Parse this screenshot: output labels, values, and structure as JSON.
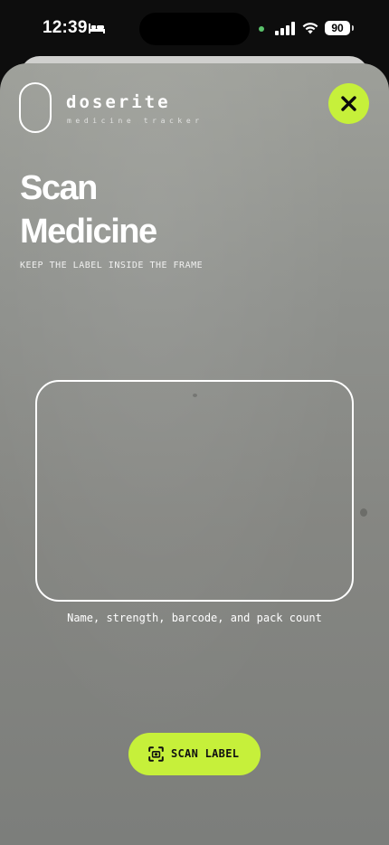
{
  "status_bar": {
    "time": "12:39",
    "battery": "90",
    "icons": [
      "bed-icon",
      "camera-indicator-dot",
      "signal-icon",
      "wifi-icon",
      "battery-icon"
    ]
  },
  "header": {
    "brand_name": "doserite",
    "brand_tagline": "medicine tracker",
    "close_icon": "close-icon"
  },
  "page": {
    "title_line1": "Scan",
    "title_line2": "Medicine",
    "subtitle": "KEEP THE LABEL INSIDE THE FRAME"
  },
  "scanner": {
    "caption": "Name, strength, barcode, and pack count"
  },
  "action": {
    "scan_label": "SCAN LABEL",
    "icon": "scan-icon"
  },
  "colors": {
    "accent": "#c6f03a",
    "text": "#ffffff",
    "status_green": "#5ac26b"
  }
}
